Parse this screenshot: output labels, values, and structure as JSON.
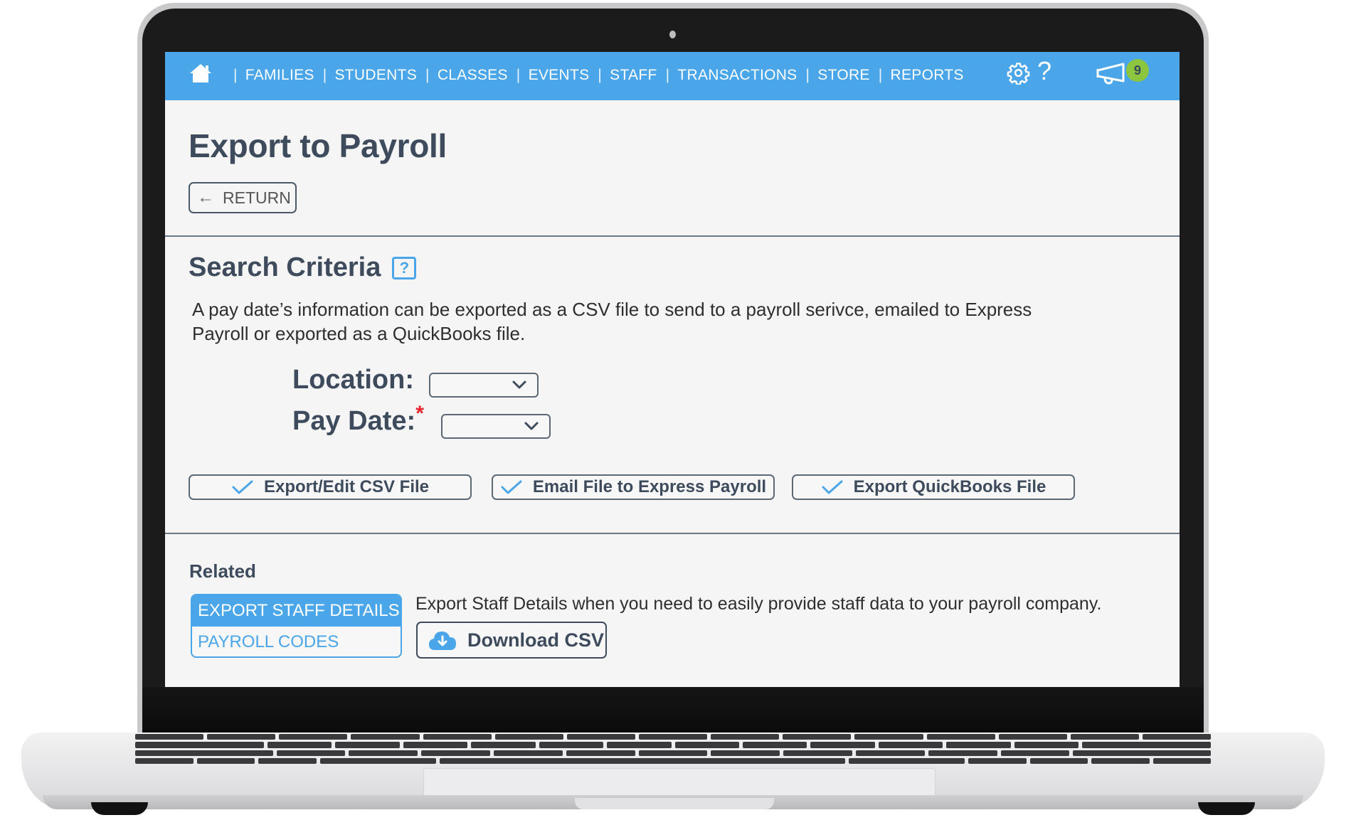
{
  "device": {
    "type": "laptop"
  },
  "nav": {
    "home_icon": "home-icon",
    "items": [
      {
        "label": "FAMILIES"
      },
      {
        "label": "STUDENTS"
      },
      {
        "label": "CLASSES"
      },
      {
        "label": "EVENTS"
      },
      {
        "label": "STAFF"
      },
      {
        "label": "TRANSACTIONS"
      },
      {
        "label": "STORE"
      },
      {
        "label": "REPORTS"
      }
    ],
    "separator": "|",
    "settings_icon": "gear-icon",
    "help_glyph": "?",
    "announcements_icon": "megaphone-icon",
    "notification_count": "9",
    "colors": {
      "bar": "#4aa6e8",
      "badge": "#8cc63f"
    }
  },
  "page": {
    "title": "Export to Payroll",
    "return_label": "RETURN",
    "return_icon": "arrow-left-icon"
  },
  "search_criteria": {
    "title": "Search Criteria",
    "help_glyph": "?",
    "description": "A pay date’s information can be exported as a CSV file to send to a payroll serivce, emailed to Express Payroll or exported as a QuickBooks file.",
    "fields": {
      "location": {
        "label": "Location:",
        "value": ""
      },
      "pay_date": {
        "label": "Pay Date:",
        "required_marker": "*",
        "value": ""
      }
    },
    "actions": [
      {
        "label": "Export/Edit CSV File",
        "icon": "check-icon"
      },
      {
        "label": "Email File to Express Payroll",
        "icon": "check-icon"
      },
      {
        "label": "Export QuickBooks File",
        "icon": "check-icon"
      }
    ]
  },
  "related": {
    "title": "Related",
    "items": [
      {
        "label": "EXPORT STAFF DETAILS",
        "active": true
      },
      {
        "label": "PAYROLL CODES",
        "active": false
      }
    ],
    "description": "Export Staff Details when you need to easily provide staff data to your payroll company.",
    "download_label": "Download CSV",
    "download_icon": "cloud-download-icon"
  }
}
